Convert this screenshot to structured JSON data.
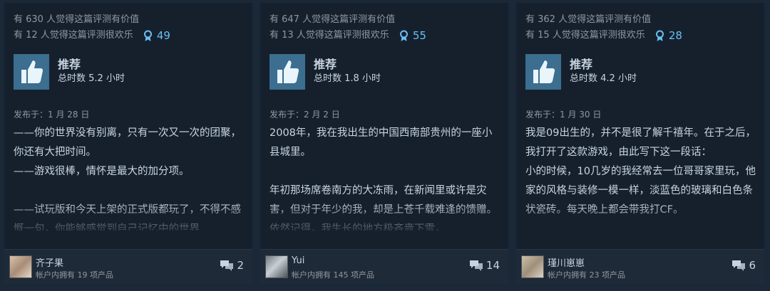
{
  "reviews": [
    {
      "helpful": "有 630 人觉得这篇评测有价值",
      "funny": "有 12 人觉得这篇评测很欢乐",
      "awards": "49",
      "verdict": "推荐",
      "hours": "总时数 5.2 小时",
      "posted": "发布于：1 月 28 日",
      "body": "——你的世界没有别离，只有一次又一次的团聚，你还有大把时间。\n——游戏很棒，情怀是最大的加分项。\n\n——试玩版和今天上架的正式版都玩了，不得不感慨一句，你能够感觉到自己记忆中的世界",
      "author": "齐子果",
      "owned": "帐户内拥有 19 项产品",
      "comments": "2"
    },
    {
      "helpful": "有 647 人觉得这篇评测有价值",
      "funny": "有 13 人觉得这篇评测很欢乐",
      "awards": "55",
      "verdict": "推荐",
      "hours": "总时数 1.8 小时",
      "posted": "发布于：2 月 2 日",
      "body": "2008年，我在我出生的中国西南部贵州的一座小县城里。\n\n年初那场席卷南方的大冻雨，在新闻里或许是灾害，但对于年少的我，却是上苍千载难逢的馈赠。依然记得，我生长的地方极吝啬下雪，",
      "author": "Yui",
      "owned": "帐户内拥有 145 项产品",
      "comments": "14"
    },
    {
      "helpful": "有 362 人觉得这篇评测有价值",
      "funny": "有 15 人觉得这篇评测很欢乐",
      "awards": "28",
      "verdict": "推荐",
      "hours": "总时数 4.2 小时",
      "posted": "发布于：1 月 30 日",
      "body": "我是09出生的，并不是很了解千禧年。在于之后，我打开了这款游戏，由此写下这一段话：\n小的时候，10几岁的我经常去一位哥哥家里玩，他家的风格与装修一模一样，淡蓝色的玻璃和白色条状瓷砖。每天晚上都会带我打CF。",
      "author": "瑾川崽崽",
      "owned": "帐户内拥有 23 项产品",
      "comments": "6"
    }
  ],
  "colors": {
    "background": "#1b2838",
    "card": "#16202d",
    "thumb_bg": "#3b6e8f",
    "accent": "#66c0f4"
  }
}
